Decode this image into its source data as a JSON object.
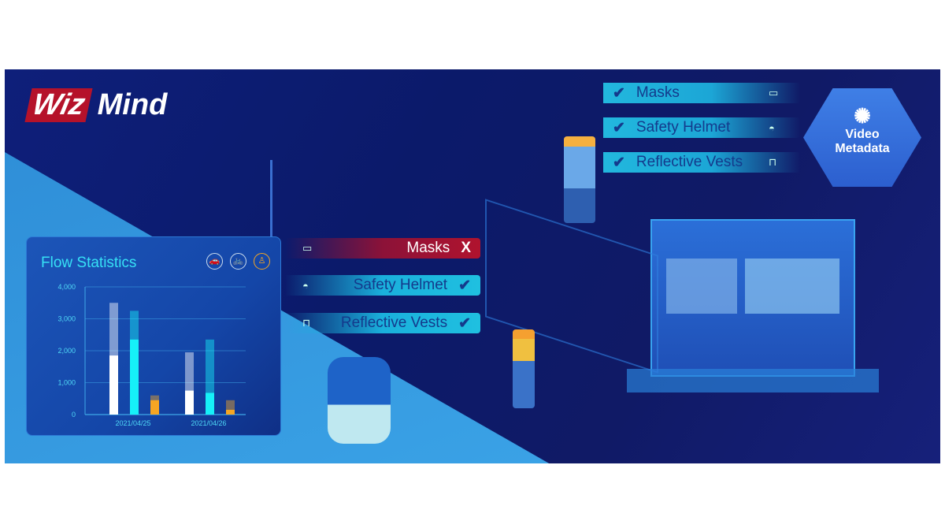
{
  "logo": {
    "part1": "Wiz",
    "part2": "Mind"
  },
  "top_tags": [
    {
      "label": "Masks",
      "status": "check",
      "icon": "mask-icon"
    },
    {
      "label": "Safety Helmet",
      "status": "check",
      "icon": "helmet-icon"
    },
    {
      "label": "Reflective Vests",
      "status": "check",
      "icon": "vest-icon"
    }
  ],
  "mid_tags": [
    {
      "label": "Masks",
      "status": "X",
      "icon": "mask-icon"
    },
    {
      "label": "Safety Helmet",
      "status": "check",
      "icon": "helmet-icon"
    },
    {
      "label": "Reflective Vests",
      "status": "check",
      "icon": "vest-icon"
    }
  ],
  "badge": {
    "line1": "Video",
    "line2": "Metadata"
  },
  "colors": {
    "accent_cyan": "#1fc0e0",
    "alert_red": "#b0132e",
    "bar_white": "#ffffff",
    "bar_cyan": "#16f0f8",
    "bar_orange": "#f5a623"
  },
  "chart_data": {
    "type": "bar",
    "title": "Flow Statistics",
    "filters": [
      "car-icon",
      "bicycle-icon",
      "pedestrian-icon"
    ],
    "categories": [
      "2021/04/25",
      "2021/04/26"
    ],
    "yticks": [
      "0",
      "1,000",
      "2,000",
      "3,000",
      "4,000"
    ],
    "ylim": [
      0,
      4000
    ],
    "grid": true,
    "series": [
      {
        "color": "#ffffff",
        "total": [
          3500,
          1950
        ],
        "highlight": [
          1850,
          750
        ]
      },
      {
        "color": "#16f0f8",
        "total": [
          3250,
          2350
        ],
        "highlight": [
          2350,
          680
        ]
      },
      {
        "color": "#f5a623",
        "total": [
          600,
          450
        ],
        "highlight": [
          450,
          150
        ]
      }
    ]
  }
}
